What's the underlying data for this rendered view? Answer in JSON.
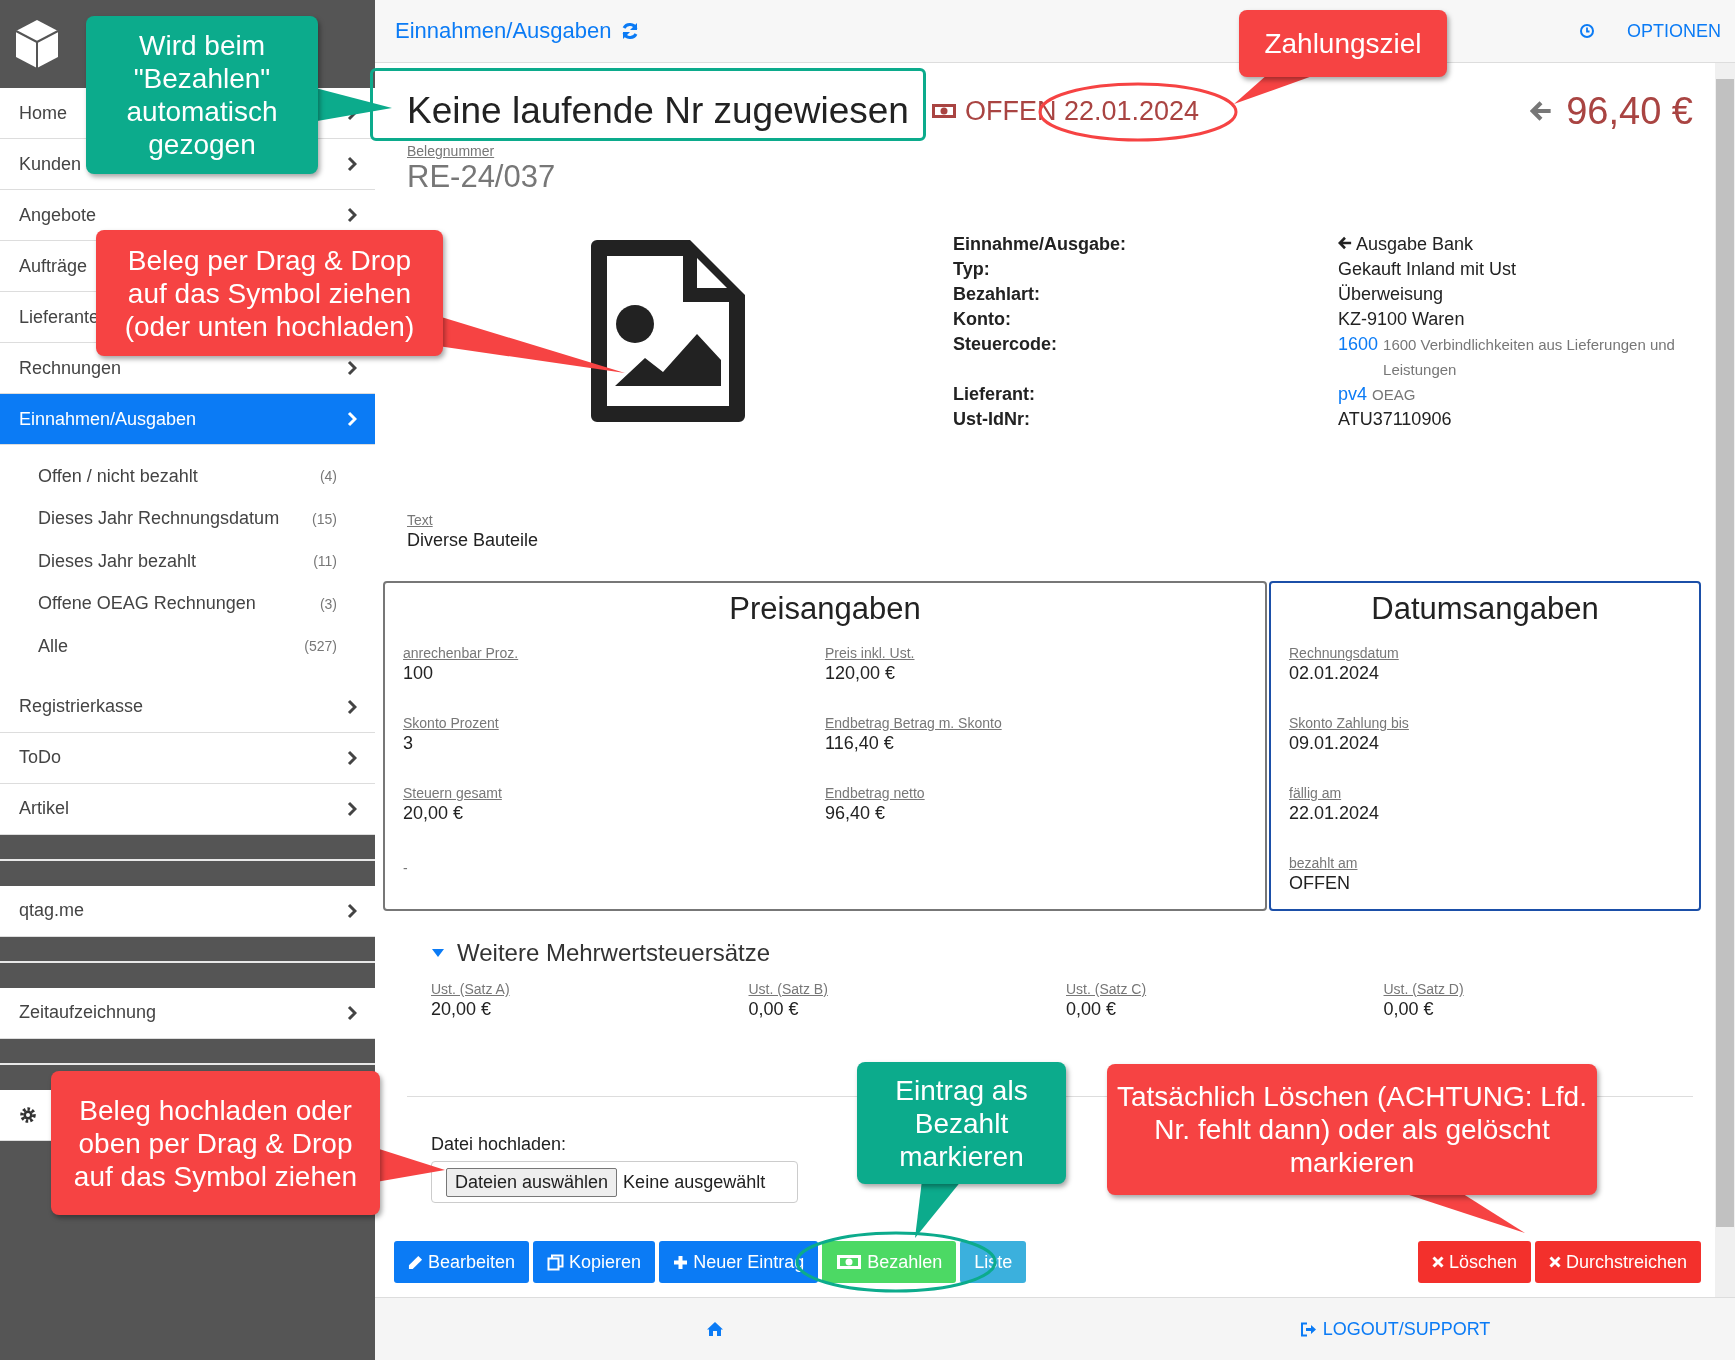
{
  "sidebar": {
    "sections": [
      [
        {
          "kind": "link",
          "label": "Home",
          "selected": false
        },
        {
          "kind": "link",
          "label": "Kunden",
          "selected": false
        },
        {
          "kind": "link",
          "label": "Angebote",
          "selected": false
        },
        {
          "kind": "link",
          "label": "Aufträge",
          "selected": false
        },
        {
          "kind": "link",
          "label": "Lieferante",
          "selected": false
        },
        {
          "kind": "link",
          "label": "Rechnungen",
          "selected": false
        },
        {
          "kind": "link",
          "label": "Einnahmen/Ausgaben",
          "selected": true,
          "children": [
            {
              "label": "Offen / nicht bezahlt",
              "count": "(4)",
              "selected": false
            },
            {
              "label": "Dieses Jahr Rechnungsdatum",
              "count": "(15)",
              "selected": false
            },
            {
              "label": "Dieses Jahr bezahlt",
              "count": "(11)",
              "selected": false
            },
            {
              "label": "Offene OEAG Rechnungen",
              "count": "(3)",
              "selected": false
            },
            {
              "label": "Alle",
              "count": "(527)",
              "selected": false
            }
          ]
        },
        {
          "kind": "link",
          "label": "Registrierkasse",
          "selected": false
        },
        {
          "kind": "link",
          "label": "ToDo",
          "selected": false
        },
        {
          "kind": "link",
          "label": "Artikel",
          "selected": false
        }
      ],
      [
        {
          "kind": "link",
          "label": "qtag.me",
          "selected": false
        }
      ],
      [
        {
          "kind": "link",
          "label": "Zeitaufzeichnung",
          "selected": false
        }
      ],
      [
        {
          "kind": "settings",
          "selected": false
        }
      ]
    ]
  },
  "header": {
    "title": "Einnahmen/Ausgaben",
    "options": "OPTIONEN"
  },
  "document": {
    "heading": "Keine laufende Nr zugewiesen",
    "status": "OFFEN 22.01.2024",
    "amount": "96,40 €",
    "number_label": "Belegnummer",
    "number": "RE-24/037"
  },
  "details": [
    {
      "kind": "direction",
      "label": "Einnahme/Ausgabe:",
      "value": "Ausgabe Bank"
    },
    {
      "kind": "text",
      "label": "Typ:",
      "value": "Gekauft Inland mit Ust"
    },
    {
      "kind": "text",
      "label": "Bezahlart:",
      "value": "Überweisung"
    },
    {
      "kind": "text",
      "label": "Konto:",
      "value": "KZ-9100 Waren"
    },
    {
      "kind": "link",
      "label": "Steuercode:",
      "link": "1600",
      "note": "1600 Verbindlichkeiten aus Lieferungen und Leistungen"
    },
    {
      "kind": "link",
      "label": "Lieferant:",
      "link": "pv4",
      "note": "OEAG"
    },
    {
      "kind": "text",
      "label": "Ust-IdNr:",
      "value": "ATU37110906"
    }
  ],
  "text_field": {
    "label": "Text",
    "value": "Diverse Bauteile"
  },
  "panels": [
    {
      "title": "Preisangaben",
      "highlighted": false,
      "fields": [
        {
          "label": "anrechenbar Proz.",
          "value": "100"
        },
        {
          "label": "Preis inkl. Ust.",
          "value": "120,00 €"
        },
        {
          "label": "Skonto Prozent",
          "value": "3"
        },
        {
          "label": "Endbetrag Betrag m. Skonto",
          "value": "116,40 €"
        },
        {
          "label": "Steuern gesamt",
          "value": "20,00 €"
        },
        {
          "label": "Endbetrag netto",
          "value": "96,40 €"
        }
      ],
      "footer": "-"
    },
    {
      "title": "Datumsangaben",
      "highlighted": true,
      "fields": [
        {
          "label": "Rechnungsdatum",
          "value": "02.01.2024"
        },
        {
          "label": "Skonto Zahlung bis",
          "value": "09.01.2024"
        },
        {
          "label": "fällig am",
          "value": "22.01.2024"
        },
        {
          "label": "bezahlt am",
          "value": "OFFEN"
        }
      ]
    }
  ],
  "vat": {
    "title": "Weitere Mehrwertsteuersätze",
    "expanded": true,
    "rates": [
      {
        "label": "Ust. (Satz A)",
        "value": "20,00 €"
      },
      {
        "label": "Ust. (Satz B)",
        "value": "0,00 €"
      },
      {
        "label": "Ust. (Satz C)",
        "value": "0,00 €"
      },
      {
        "label": "Ust. (Satz D)",
        "value": "0,00 €"
      }
    ]
  },
  "upload": {
    "label": "Datei hochladen:",
    "button": "Dateien auswählen",
    "value": "Keine ausgewählt"
  },
  "actions": [
    {
      "label": "Bearbeiten",
      "kind": "primary"
    },
    {
      "label": "Kopieren",
      "kind": "primary"
    },
    {
      "label": "Neuer Eintrag",
      "kind": "primary"
    },
    {
      "label": "Bezahlen",
      "kind": "success"
    },
    {
      "label": "Liste",
      "kind": "info"
    },
    {
      "label": "Löschen",
      "kind": "danger"
    },
    {
      "label": "Durchstreichen",
      "kind": "danger"
    }
  ],
  "footer": {
    "logout": "LOGOUT/SUPPORT"
  },
  "annotations": [
    {
      "kind": "callout",
      "color": "#0cab8c",
      "text": "Wird beim \"Bezahlen\" automatisch gezogen"
    },
    {
      "kind": "frame",
      "color": "#0cab8c"
    },
    {
      "kind": "callout",
      "color": "#f64343",
      "text": "Zahlungsziel"
    },
    {
      "kind": "ellipse",
      "color": "#f64343"
    },
    {
      "kind": "callout",
      "color": "#f64343",
      "text": "Beleg per Drag & Drop auf das Symbol ziehen (oder unten hochladen)"
    },
    {
      "kind": "callout",
      "color": "#f64343",
      "text": "Beleg hochladen oder oben per Drag & Drop auf das Symbol ziehen"
    },
    {
      "kind": "callout",
      "color": "#0cab8c",
      "text": "Eintrag als Bezahlt markieren"
    },
    {
      "kind": "ellipse",
      "color": "#0cab8c"
    },
    {
      "kind": "callout",
      "color": "#f64343",
      "text": "Tatsächlich Löschen (ACHTUNG: Lfd. Nr. fehlt dann) oder als gelöscht markieren"
    }
  ]
}
